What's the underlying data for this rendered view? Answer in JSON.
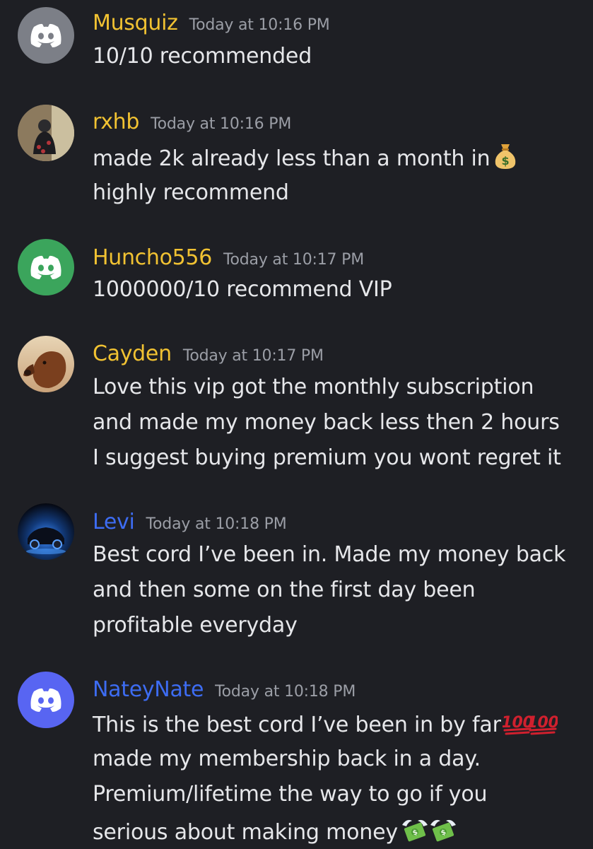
{
  "colors": {
    "background": "#1e1f24",
    "text": "#e6e7ea",
    "timestamp": "#9b9ea6",
    "name_gold": "#f1c232",
    "name_blue": "#3d6cf2",
    "avatar_grey": "#7c7f87",
    "avatar_green": "#3ba55c",
    "avatar_blurple": "#5865f2"
  },
  "messages": [
    {
      "username": "Musquiz",
      "timestamp": "Today at 10:16 PM",
      "avatar_icon": "discord-logo-icon",
      "lines": [
        "10/10 recommended"
      ]
    },
    {
      "username": "rxhb",
      "timestamp": "Today at 10:16 PM",
      "avatar_icon": "profile-photo",
      "lines": [
        "made 2k already less than a month in",
        "highly recommend"
      ],
      "emoji": [
        "money-bag-icon"
      ]
    },
    {
      "username": "Huncho556",
      "timestamp": "Today at 10:17 PM",
      "avatar_icon": "discord-logo-icon",
      "lines": [
        "1000000/10 recommend VIP"
      ]
    },
    {
      "username": "Cayden",
      "timestamp": "Today at 10:17 PM",
      "avatar_icon": "dog-photo",
      "lines": [
        "Love this vip got the monthly subscription",
        "and made my money back less then 2 hours",
        "I suggest buying premium you wont regret it"
      ]
    },
    {
      "username": "Levi",
      "timestamp": "Today at 10:18 PM",
      "avatar_icon": "car-photo",
      "lines": [
        "Best cord I’ve been in. Made my money back",
        "and then some on the first day been",
        "profitable everyday"
      ]
    },
    {
      "username": "NateyNate",
      "timestamp": "Today at 10:18 PM",
      "avatar_icon": "discord-logo-icon",
      "lines": [
        "This is the best cord I’ve been in by far",
        "made my membership back in a day.",
        "Premium/lifetime the way to go if you",
        "serious about making money"
      ],
      "emoji": [
        "hundred-points-icon",
        "hundred-points-icon",
        "money-with-wings-icon",
        "money-with-wings-icon"
      ]
    }
  ]
}
